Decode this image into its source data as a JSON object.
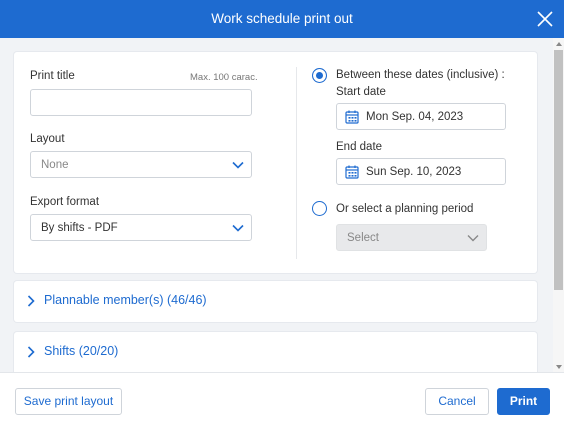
{
  "dialog": {
    "title": "Work schedule print out"
  },
  "form": {
    "print_title_label": "Print title",
    "print_title_hint": "Max. 100 carac.",
    "print_title_value": "",
    "layout_label": "Layout",
    "layout_value": "None",
    "export_format_label": "Export format",
    "export_format_value": "By shifts - PDF"
  },
  "date_range": {
    "between_label": "Between these dates (inclusive) :",
    "between_selected": true,
    "start_label": "Start date",
    "start_value": "Mon Sep. 04, 2023",
    "end_label": "End date",
    "end_value": "Sun Sep. 10, 2023",
    "period_label": "Or select a planning period",
    "period_selected": false,
    "period_placeholder": "Select"
  },
  "sections": [
    {
      "label": "Plannable member(s) (46/46)",
      "expanded": false
    },
    {
      "label": "Shifts (20/20)",
      "expanded": false
    }
  ],
  "footer": {
    "save_layout_label": "Save print layout",
    "cancel_label": "Cancel",
    "print_label": "Print"
  },
  "colors": {
    "accent": "#1e6bd0",
    "background": "#f1f3f6"
  },
  "icons": {
    "close": "close-icon",
    "calendar": "calendar-icon",
    "chevron_down": "chevron-down-icon",
    "chevron_right": "chevron-right-icon"
  }
}
